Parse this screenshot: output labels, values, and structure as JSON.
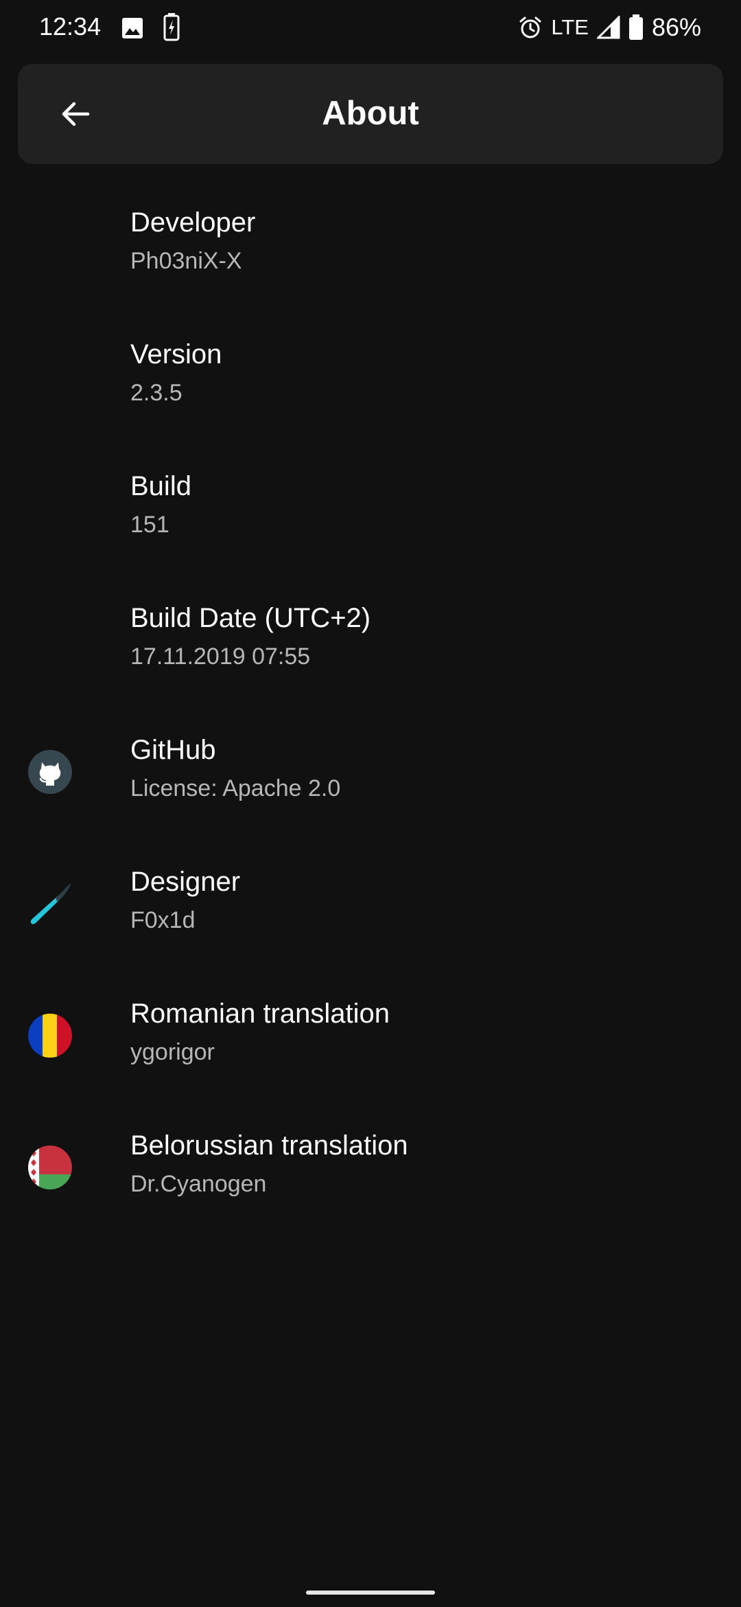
{
  "status_bar": {
    "time": "12:34",
    "network": "LTE",
    "battery": "86%"
  },
  "toolbar": {
    "title": "About"
  },
  "items": [
    {
      "title": "Developer",
      "subtitle": "Ph03niX-X"
    },
    {
      "title": "Version",
      "subtitle": "2.3.5"
    },
    {
      "title": "Build",
      "subtitle": "151"
    },
    {
      "title": "Build Date (UTC+2)",
      "subtitle": "17.11.2019 07:55"
    },
    {
      "title": "GitHub",
      "subtitle": "License: Apache 2.0",
      "icon": "github-icon"
    },
    {
      "title": "Designer",
      "subtitle": "F0x1d",
      "icon": "brush-icon"
    },
    {
      "title": "Romanian translation",
      "subtitle": "ygorigor",
      "icon": "romania-flag-icon"
    },
    {
      "title": "Belorussian translation",
      "subtitle": "Dr.Cyanogen",
      "icon": "belarus-flag-icon"
    }
  ],
  "colors": {
    "background": "#111111",
    "toolbar": "#212121",
    "primary_text": "#ffffff",
    "secondary_text": "#b7b7b7"
  }
}
